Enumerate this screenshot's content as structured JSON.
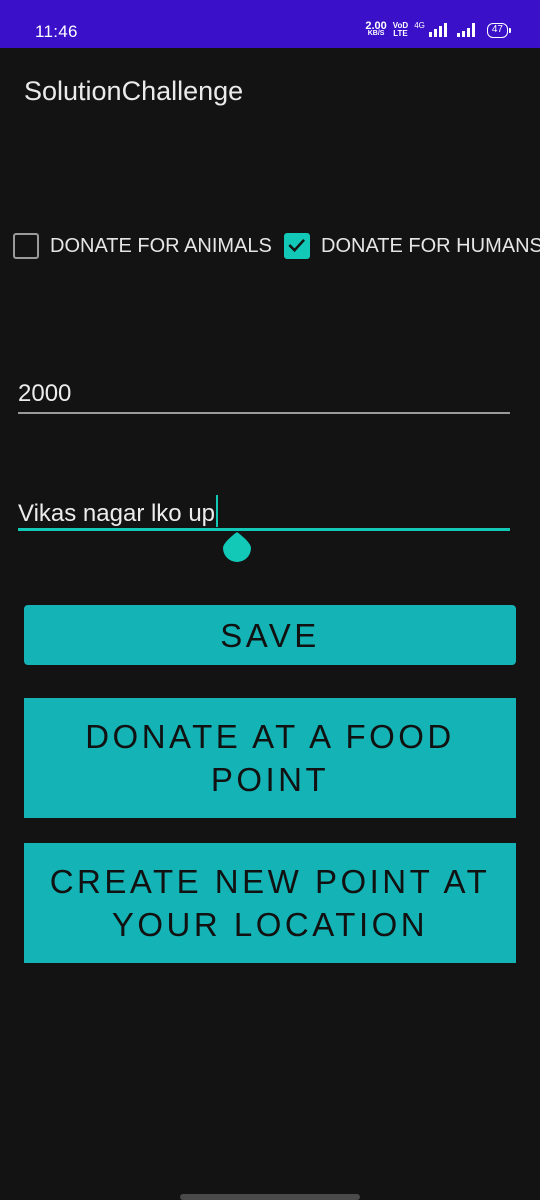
{
  "status_bar": {
    "time": "11:46",
    "net_speed_value": "2.00",
    "net_speed_unit": "KB/S",
    "volte_top": "VoD",
    "volte_bottom": "LTE",
    "network_type": "4G",
    "battery": "47",
    "bg_color": "#3a10c9"
  },
  "app": {
    "title": "SolutionChallenge",
    "accent_color": "#12c9b8",
    "button_color": "#14b3b5"
  },
  "checkboxes": [
    {
      "label": "DONATE FOR ANIMALS",
      "checked": false
    },
    {
      "label": "DONATE FOR HUMANS",
      "checked": true
    }
  ],
  "fields": {
    "amount": {
      "value": "2000"
    },
    "address": {
      "value": "Vikas nagar lko up"
    }
  },
  "buttons": {
    "save": "SAVE",
    "donate": "DONATE AT A FOOD POINT",
    "create": "CREATE NEW POINT AT YOUR LOCATION"
  }
}
